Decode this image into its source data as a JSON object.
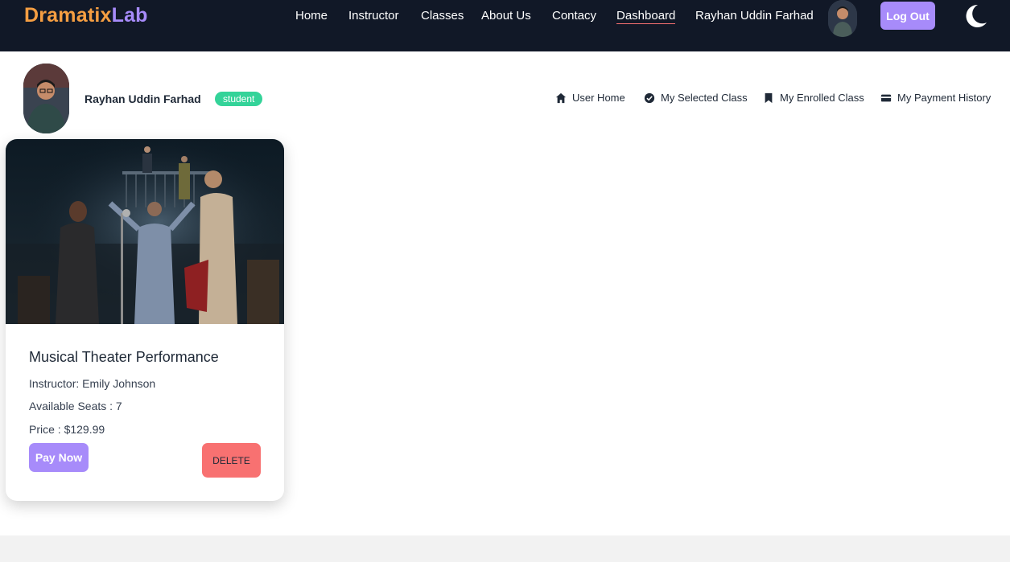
{
  "brand": {
    "part1": "Dramatix",
    "part2": "Lab"
  },
  "nav": {
    "links": [
      "Home",
      "Instructor",
      "Classes",
      "About Us",
      "Contacy",
      "Dashboard"
    ],
    "user_name": "Rayhan Uddin Farhad",
    "logout_label": "Log Out"
  },
  "dashboard": {
    "user_name": "Rayhan Uddin Farhad",
    "role": "student",
    "links": [
      "User Home",
      "My Selected Class",
      "My Enrolled Class",
      "My Payment History"
    ]
  },
  "card": {
    "title": "Musical Theater Performance",
    "instructor": "Instructor: Emily Johnson",
    "seats": "Available Seats : 7",
    "price": "Price : $129.99",
    "pay_label": "Pay Now",
    "delete_label": "DELETE"
  },
  "colors": {
    "accent": "#a78bfa",
    "brand_orange": "#f59e42",
    "badge": "#34d399",
    "danger": "#f87171",
    "nav_bg": "#111827"
  }
}
